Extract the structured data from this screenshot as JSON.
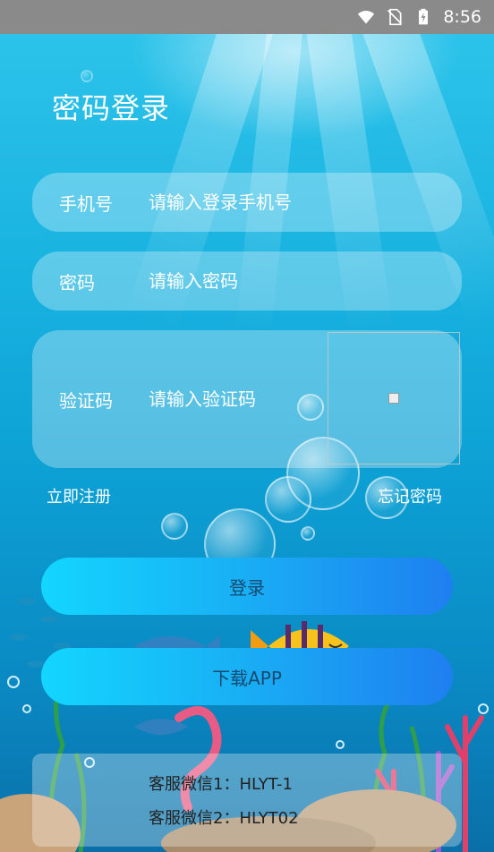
{
  "status_bar": {
    "time": "8:56",
    "icons": [
      "wifi-icon",
      "no-sim-icon",
      "battery-charging-icon"
    ]
  },
  "login": {
    "title": "密码登录",
    "phone": {
      "label": "手机号",
      "placeholder": "请输入登录手机号"
    },
    "password": {
      "label": "密码",
      "placeholder": "请输入密码"
    },
    "captcha": {
      "label": "验证码",
      "placeholder": "请输入验证码"
    },
    "register_link": "立即注册",
    "forgot_link": "忘记密码",
    "login_button": "登录",
    "download_button": "下载APP"
  },
  "service": {
    "line1": "客服微信1：HLYT-1",
    "line2": "客服微信2：HLYT02"
  },
  "colors": {
    "button_start": "#13d6ff",
    "button_end": "#1e7ff0",
    "water": "#18b2e0"
  }
}
